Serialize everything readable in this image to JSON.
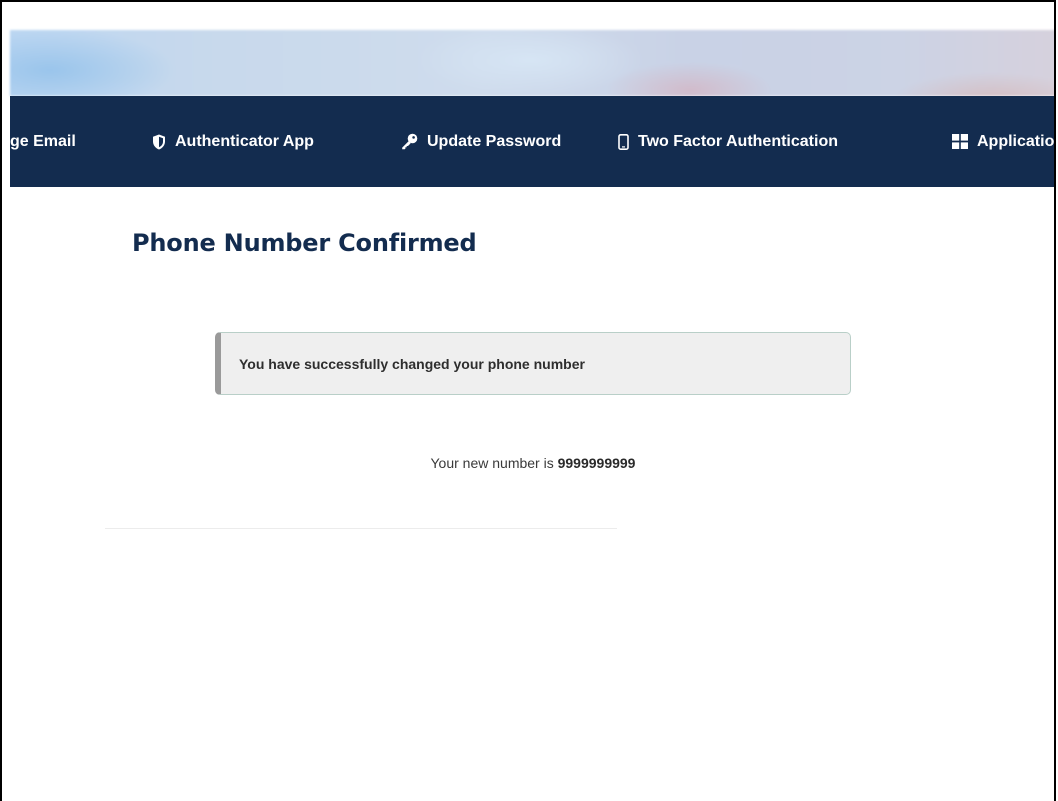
{
  "nav": {
    "items": [
      {
        "label": "ge Email",
        "icon": "none"
      },
      {
        "label": "Authenticator App",
        "icon": "shield-icon"
      },
      {
        "label": "Update Password",
        "icon": "key-icon"
      },
      {
        "label": "Two Factor Authentication",
        "icon": "mobile-phone-icon"
      },
      {
        "label": "Applicatio",
        "icon": "grid-icon"
      }
    ],
    "background_color": "#132c4f"
  },
  "main": {
    "title": "Phone Number Confirmed",
    "alert": {
      "message": "You have successfully changed your phone number"
    },
    "new_number": {
      "prefix": "Your new number is",
      "value": "9999999999"
    }
  },
  "colors": {
    "title": "#132c4f",
    "alert_background": "#efefef",
    "alert_accent": "#9a9a9a"
  }
}
